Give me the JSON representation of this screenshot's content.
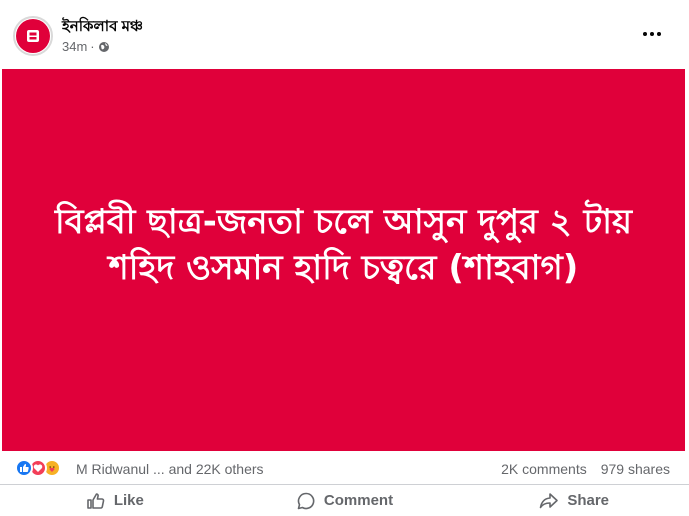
{
  "post": {
    "page_name": "ইনকিলাব মঞ্চ",
    "time": "34m",
    "privacy_icon": "globe-icon",
    "more_icon": "more-options-icon",
    "banner": {
      "line1": "বিপ্লবী ছাত্র-জনতা চলে আসুন দুপুর ২ টায়",
      "line2": "শহিদ ওসমান হাদি চত্বরে (শাহবাগ)",
      "background": "#e0003a"
    },
    "reactions": {
      "icons": [
        "like-icon",
        "love-icon",
        "care-icon"
      ],
      "summary": "M Ridwanul ... and 22K others",
      "comments": "2K comments",
      "shares": "979 shares"
    },
    "actions": {
      "like": "Like",
      "comment": "Comment",
      "share": "Share"
    }
  },
  "colors": {
    "accent": "#e0003a",
    "secondary_text": "#65676b",
    "like_blue": "#1877f2"
  }
}
